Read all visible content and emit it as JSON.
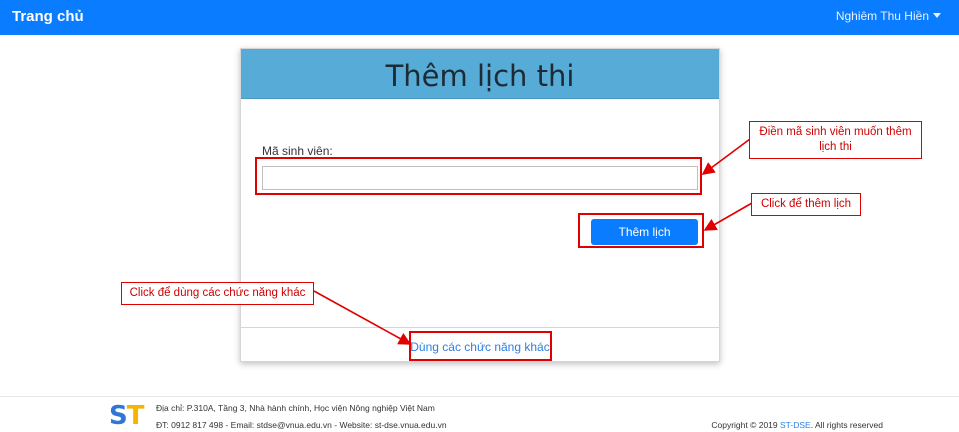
{
  "navbar": {
    "brand": "Trang chủ",
    "user_name": "Nghiêm Thu Hiền"
  },
  "card": {
    "title": "Thêm lịch thi",
    "student_id_label": "Mã sinh viên:",
    "student_id_value": "",
    "submit_label": "Thêm lịch",
    "other_functions_link": "Dùng các chức năng khác"
  },
  "annotations": {
    "input_hint": "Điền mã sinh viên muốn thêm lịch thi",
    "button_hint": "Click để thêm lịch",
    "link_hint": "Click để dùng các chức năng khác"
  },
  "footer": {
    "logo_s": "S",
    "logo_t": "T",
    "address": "Địa chỉ: P.310A, Tầng 3, Nhà hành chính, Học viện Nông nghiệp Việt Nam",
    "contact": "ĐT: 0912 817 498 - Email: stdse@vnua.edu.vn - Website: st-dse.vnua.edu.vn",
    "copyright_prefix": "Copyright © 2019",
    "copyright_brand": "ST-DSE",
    "copyright_suffix": ". All rights reserved"
  },
  "colors": {
    "navbar": "#0a7cff",
    "card_header": "#56acd6",
    "annotation_red": "#e00000",
    "logo_s": "#2f76d8",
    "logo_t": "#f4b400"
  }
}
